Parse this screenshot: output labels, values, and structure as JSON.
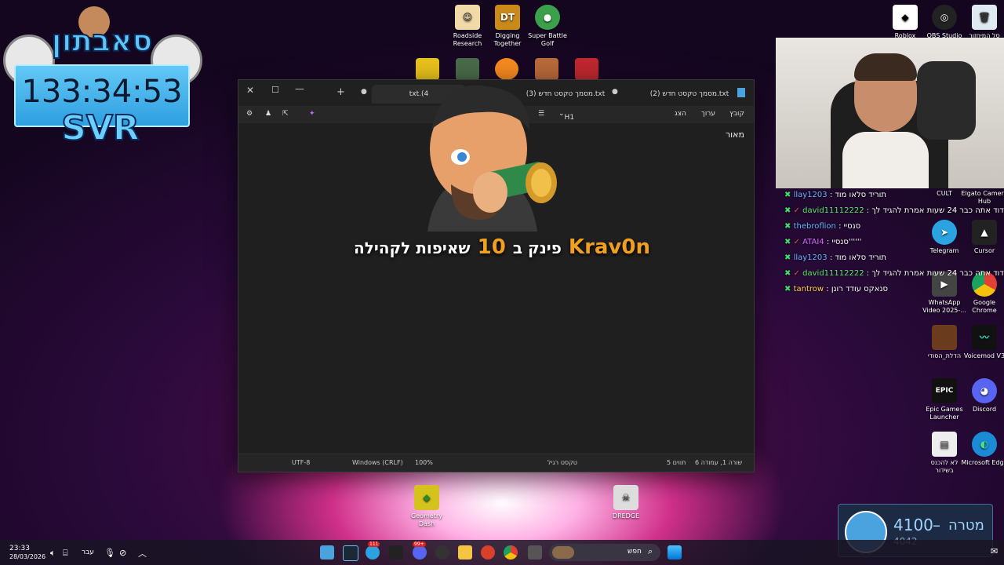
{
  "desktop_icons_top": [
    {
      "label": "Roadside Research",
      "color": "#f1d9a8",
      "glyph": "☺"
    },
    {
      "label": "Digging Together",
      "color": "#c98a1a",
      "glyph": "DT"
    },
    {
      "label": "Super Battle Golf",
      "color": "#3aa14a",
      "glyph": "●"
    }
  ],
  "desktop_icons_right": [
    {
      "label": "Roblox",
      "color": "#ffffff",
      "glyph": "◆"
    },
    {
      "label": "OBS Studio",
      "color": "#222",
      "glyph": "◎"
    },
    {
      "label": "סל המיחזור",
      "color": "#dfe9f2",
      "glyph": "🗑"
    }
  ],
  "desktop_icons_side": [
    {
      "label": "CULT",
      "color": "#333",
      "glyph": ""
    },
    {
      "label": "Elgato Camera Hub",
      "color": "#111",
      "glyph": ""
    },
    {
      "label": "Telegram",
      "color": "#2aa3e0",
      "glyph": "➤"
    },
    {
      "label": "Cursor",
      "color": "#222",
      "glyph": "▲"
    },
    {
      "label": "WhatsApp Video 2025-...",
      "color": "#444",
      "glyph": "▶"
    },
    {
      "label": "Google Chrome",
      "color": "#e34133",
      "glyph": "◉"
    },
    {
      "label": "הדלת_הסודי",
      "color": "#6a3b1c",
      "glyph": ""
    },
    {
      "label": "Voicemod V3",
      "color": "#111",
      "glyph": "〰"
    },
    {
      "label": "Epic Games Launcher",
      "color": "#111",
      "glyph": "EPIC"
    },
    {
      "label": "Discord",
      "color": "#5865f2",
      "glyph": "◕"
    },
    {
      "label": "לא להכנס בשידור",
      "color": "#eee",
      "glyph": "▤"
    },
    {
      "label": "Microsoft Edge",
      "color": "#1b8bd6",
      "glyph": "◐"
    }
  ],
  "desktop_icons_bottom": [
    {
      "label": "Geometry Dash",
      "color": "#d4c31c",
      "glyph": "◆"
    },
    {
      "label": "DREDGE",
      "color": "#ddd",
      "glyph": "☠"
    }
  ],
  "overlay": {
    "banner": "סאבתון",
    "timer": "133:34:53",
    "tag": "SVR"
  },
  "notepad": {
    "tabs": [
      {
        "label": "txt.(4",
        "active": true
      },
      {
        "label": "מסמך טקסט חדש (3).txt",
        "active": false
      },
      {
        "label": "מסמך טקסט חדש (2).txt",
        "active": false
      }
    ],
    "menu": {
      "file": "קובץ",
      "edit": "ערוך",
      "view": "הצג",
      "heading": "H1"
    },
    "content": "מאור",
    "status": {
      "position": "שורה 1, עמודה 6",
      "chars": "5 תווים",
      "format": "טקסט רגיל",
      "zoom": "100%",
      "eol": "Windows (CRLF)",
      "encoding": "UTF-8"
    }
  },
  "alert": {
    "user": "Krav0n",
    "text1": "פינק ב",
    "amount": "10",
    "text2": "שאיפות לקהילה"
  },
  "chat": [
    {
      "user": "llay1203",
      "msg": "תוריד סלאו מוד",
      "color": "#6bb5ff"
    },
    {
      "user": "david11112222",
      "msg": "דוד אתה כבר 24 שעות אמרת להגיד לך",
      "color": "#5ce86f"
    },
    {
      "user": "thebroflion",
      "msg": "סנסיי",
      "color": "#6bb5ff"
    },
    {
      "user": "ATAI4",
      "msg": "סנסיי''''''",
      "color": "#d66bff"
    },
    {
      "user": "llay1203",
      "msg": "תוריד סלאו מוד",
      "color": "#6bb5ff"
    },
    {
      "user": "david11112222",
      "msg": "דוד אתה כבר 24 שעות אמרת להגיד לך",
      "color": "#5ce86f"
    },
    {
      "user": "tantrow",
      "msg": "סנאקס עודד רונן",
      "color": "#ffd24a"
    }
  ],
  "goal": {
    "label": "מטרה",
    "current": "4100",
    "target": "4042"
  },
  "taskbar": {
    "time": "23:33",
    "date": "28/03/2026",
    "lang": "עבר",
    "search": "חפש",
    "badge1": "111",
    "badge2": "99+"
  }
}
